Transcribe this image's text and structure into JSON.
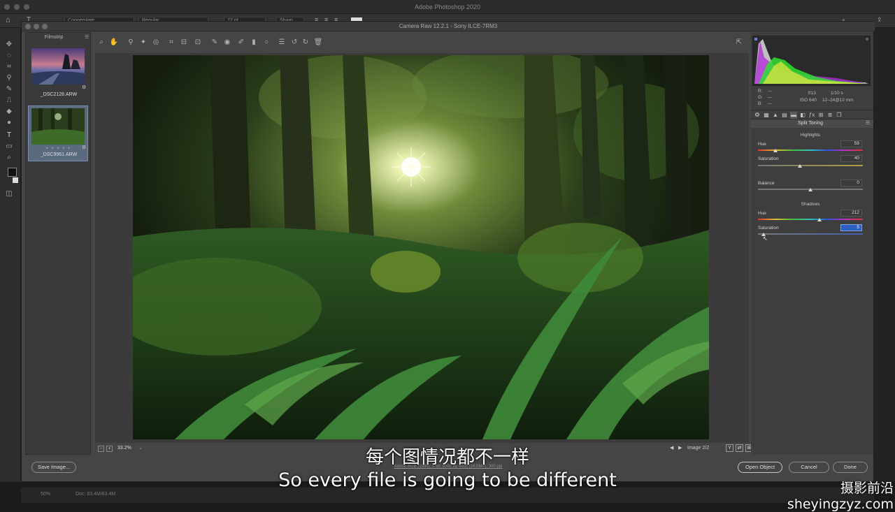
{
  "photoshop": {
    "title": "Adobe Photoshop 2020",
    "options_bar": {
      "font_family": "Copperplate",
      "font_style": "Regular",
      "font_size": "72 pt",
      "antialias": "Sharp"
    },
    "status": {
      "zoom": "50%",
      "doc": "Doc: 83.4M/83.4M"
    }
  },
  "camera_raw": {
    "title": "Camera Raw 12.2.1  -  Sony ILCE-7RM3",
    "filmstrip": {
      "title": "Filmstrip",
      "items": [
        {
          "filename": "_DSC2128.ARW",
          "selected": false
        },
        {
          "filename": "_DSC9961.ARW",
          "selected": true,
          "stars": "• • • • •"
        }
      ]
    },
    "histogram_info": {
      "r_label": "R:",
      "r_value": "---",
      "g_label": "G:",
      "g_value": "---",
      "b_label": "B:",
      "b_value": "---",
      "aperture": "f/13",
      "shutter": "1/10 s",
      "iso": "ISO 640",
      "lens": "12–24@12 mm"
    },
    "panel": {
      "title": "Split Toning",
      "highlights": {
        "label": "Highlights",
        "hue_label": "Hue",
        "hue_value": "59",
        "hue_pct": 0.164,
        "saturation_label": "Saturation",
        "saturation_value": "40",
        "saturation_pct": 0.4
      },
      "balance": {
        "label": "Balance",
        "value": "0",
        "pct": 0.5
      },
      "shadows": {
        "label": "Shadows",
        "hue_label": "Hue",
        "hue_value": "212",
        "hue_pct": 0.589,
        "saturation_label": "Saturation",
        "saturation_value": "5",
        "saturation_pct": 0.05
      }
    },
    "preview_bar": {
      "zoom": "33.2%",
      "image_counter": "Image 2/2"
    },
    "workflow_link": "Adobe RGB (1998); 8 bit; 6000 by 4000 (24.0MP); 300 ppi",
    "buttons": {
      "save_image": "Save Image...",
      "open_object": "Open Object",
      "cancel": "Cancel",
      "done": "Done"
    }
  },
  "subtitles": {
    "cn": "每个图情况都不一样",
    "en": "So every file is going to be different"
  },
  "watermark": "摄影前沿 sheyingzyz.com",
  "colors": {
    "accent_blue": "#2c5fbf",
    "selected_thumb": "#5a6a7f",
    "panel_bg": "#3e3e3e"
  }
}
